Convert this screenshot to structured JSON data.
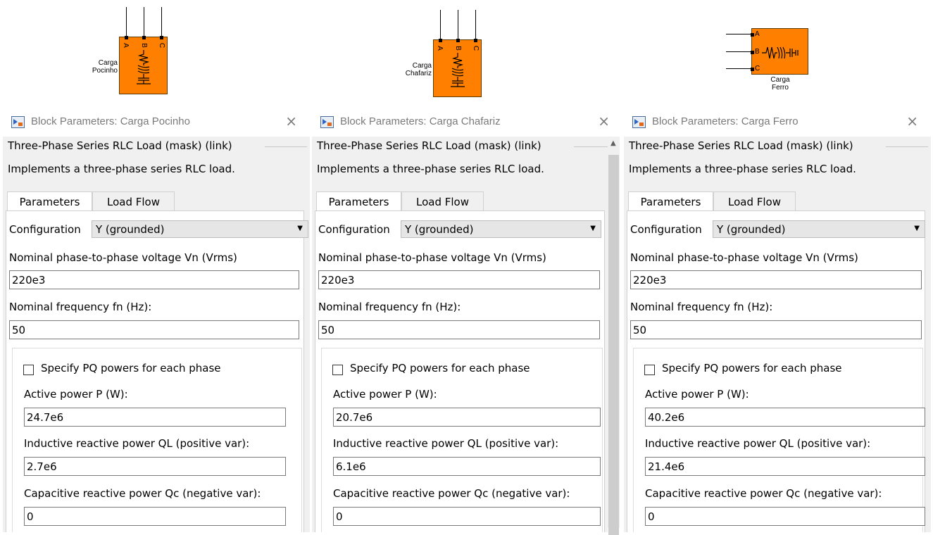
{
  "blocks": [
    {
      "name_line1": "Carga",
      "name_line2": "Pocinho",
      "ports": [
        "A",
        "B",
        "C"
      ]
    },
    {
      "name_line1": "Carga",
      "name_line2": "Chafariz",
      "ports": [
        "A",
        "B",
        "C"
      ]
    },
    {
      "name_line1": "Carga",
      "name_line2": "Ferro",
      "ports": [
        "A",
        "B",
        "C"
      ]
    }
  ],
  "dialogs": [
    {
      "title": "Block Parameters: Carga Pocinho",
      "close": "×",
      "heading": "Three-Phase Series RLC Load (mask) (link)",
      "description": "Implements a three-phase series RLC load.",
      "tabs": [
        "Parameters",
        "Load Flow"
      ],
      "configuration_label": "Configuration",
      "configuration_value": "Y (grounded)",
      "voltage_label": "Nominal phase-to-phase voltage Vn (Vrms)",
      "voltage_value": "220e3",
      "frequency_label": "Nominal frequency fn (Hz):",
      "frequency_value": "50",
      "pq_checkbox_label": "Specify PQ powers for each phase",
      "active_label": "Active power P (W):",
      "active_value": "24.7e6",
      "inductive_label": "Inductive reactive power QL (positive var):",
      "inductive_value": "2.7e6",
      "capacitive_label": "Capacitive reactive power Qc (negative var):",
      "capacitive_value": "0"
    },
    {
      "title": "Block Parameters: Carga Chafariz",
      "close": "×",
      "heading": "Three-Phase Series RLC Load (mask) (link)",
      "description": "Implements a three-phase series RLC load.",
      "tabs": [
        "Parameters",
        "Load Flow"
      ],
      "configuration_label": "Configuration",
      "configuration_value": "Y (grounded)",
      "voltage_label": "Nominal phase-to-phase voltage Vn (Vrms)",
      "voltage_value": "220e3",
      "frequency_label": "Nominal frequency fn (Hz):",
      "frequency_value": "50",
      "pq_checkbox_label": "Specify PQ powers for each phase",
      "active_label": "Active power P (W):",
      "active_value": "20.7e6",
      "inductive_label": "Inductive reactive power QL (positive var):",
      "inductive_value": "6.1e6",
      "capacitive_label": "Capacitive reactive power Qc (negative var):",
      "capacitive_value": "0"
    },
    {
      "title": "Block Parameters: Carga Ferro",
      "close": "×",
      "heading": "Three-Phase Series RLC Load (mask) (link)",
      "description": "Implements a three-phase series RLC load.",
      "tabs": [
        "Parameters",
        "Load Flow"
      ],
      "configuration_label": "Configuration",
      "configuration_value": "Y (grounded)",
      "voltage_label": "Nominal phase-to-phase voltage Vn (Vrms)",
      "voltage_value": "220e3",
      "frequency_label": "Nominal frequency fn (Hz):",
      "frequency_value": "50",
      "pq_checkbox_label": "Specify PQ powers for each phase",
      "active_label": "Active power P (W):",
      "active_value": "40.2e6",
      "inductive_label": "Inductive reactive power QL (positive var):",
      "inductive_value": "21.4e6",
      "capacitive_label": "Capacitive reactive power Qc (negative var):",
      "capacitive_value": "0"
    }
  ],
  "colors": {
    "block_fill": "#ff8000",
    "dialog_bg": "#f0f0f0"
  },
  "icons": [
    "simulink-block-icon",
    "close-icon",
    "dropdown-arrow-icon",
    "checkbox-icon",
    "scroll-up-icon"
  ]
}
